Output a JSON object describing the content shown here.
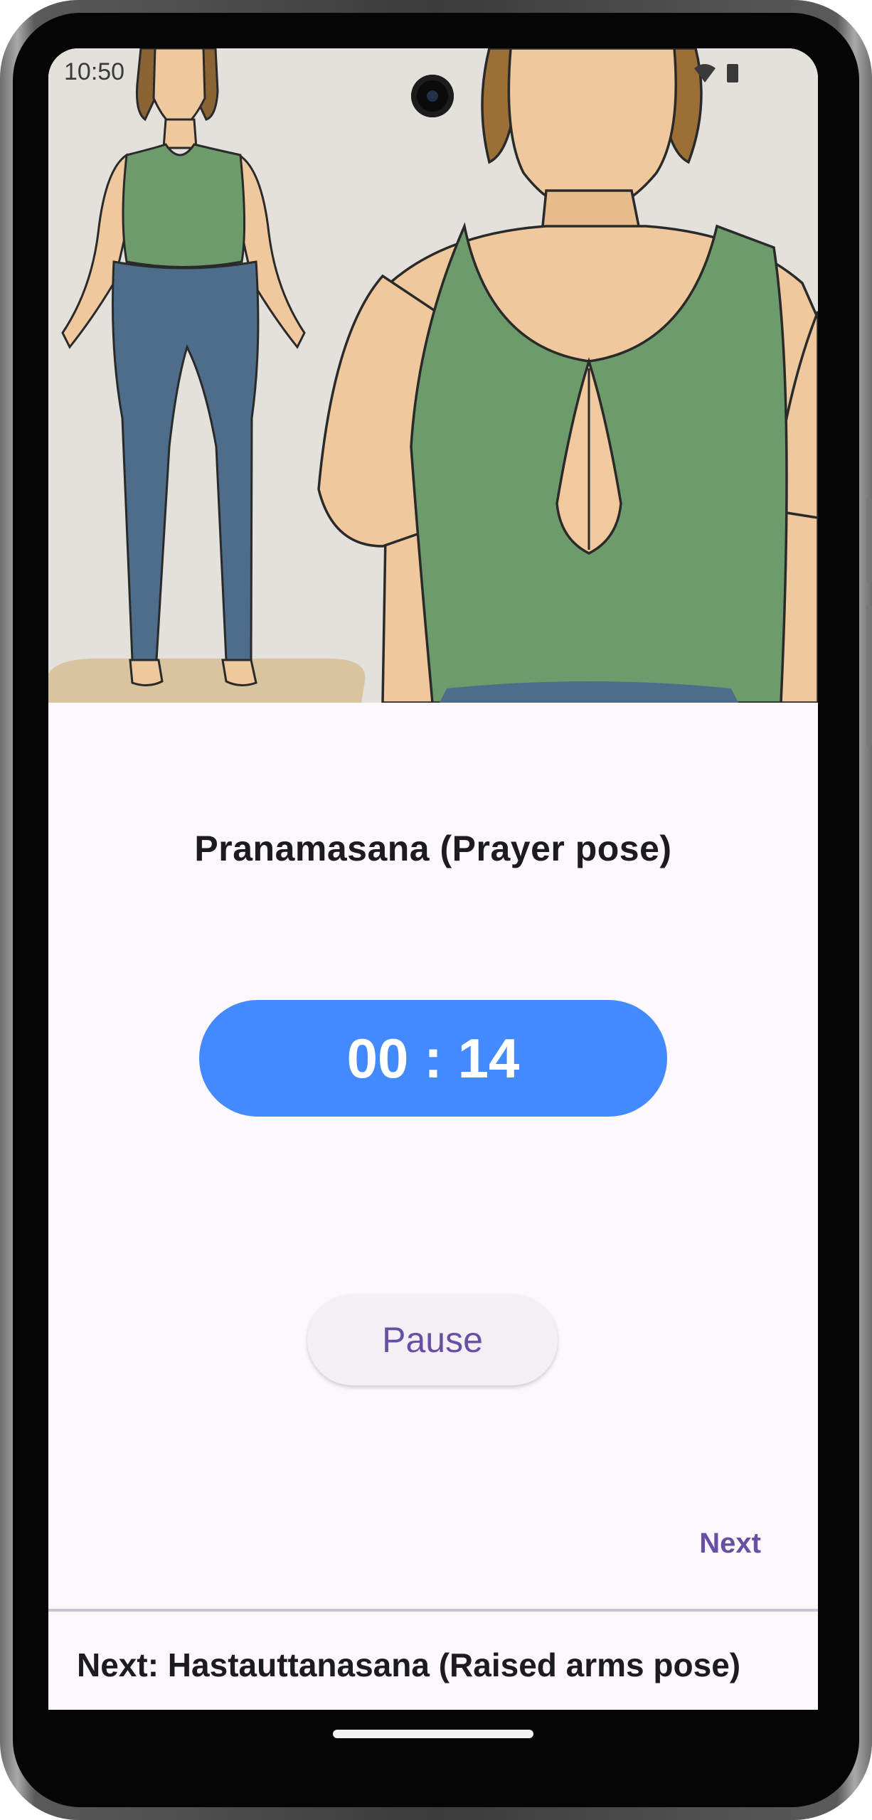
{
  "status_bar": {
    "time": "10:50"
  },
  "pose": {
    "title": "Pranamasana (Prayer pose)",
    "image_alt": "illustration-standing-prayer-pose"
  },
  "timer": {
    "display": "00 : 14"
  },
  "controls": {
    "pause_label": "Pause",
    "next_label": "Next"
  },
  "upcoming": {
    "text": "Next: Hastauttanasana (Raised arms pose)"
  },
  "colors": {
    "timer_bg": "#448aff",
    "accent": "#6750a4",
    "screen_bg": "#fdf8fb",
    "button_bg": "#f4eff5"
  }
}
